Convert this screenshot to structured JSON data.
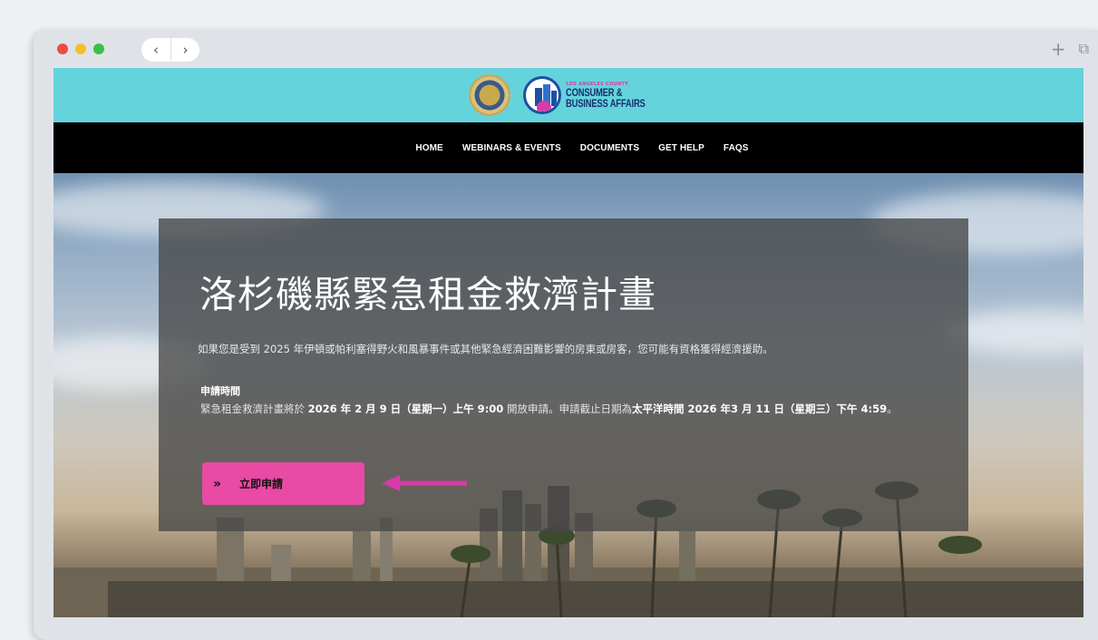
{
  "browser": {
    "back_icon": "‹",
    "forward_icon": "›",
    "new_tab_icon": "+",
    "windows_icon": "⧉"
  },
  "header": {
    "logo_small": "LOS ANGELES COUNTY",
    "logo_line1": "CONSUMER &",
    "logo_line2": "BUSINESS AFFAIRS"
  },
  "nav": {
    "items": [
      {
        "label": "HOME"
      },
      {
        "label": "WEBINARS & EVENTS"
      },
      {
        "label": "DOCUMENTS"
      },
      {
        "label": "GET HELP"
      },
      {
        "label": "FAQS"
      }
    ]
  },
  "hero": {
    "title": "洛杉磯縣緊急租金救濟計畫",
    "description": "如果您是受到 2025 年伊頓或帕利塞得野火和風暴事件或其他緊急經濟困難影響的房東或房客，您可能有資格獲得經濟援助。",
    "period_title": "申請時間",
    "period_text1": "緊急租金救濟計畫將於 ",
    "period_bold1": "2026 年 2 月 9 日（星期一）上午 9:00",
    "period_text2": " 開放申請。申請截止日期為",
    "period_bold2": "太平洋時間 2026 年3 月 11 日（星期三）下午 4:59",
    "period_text3": "。",
    "apply_chevron": "»",
    "apply_label": "立即申請"
  },
  "colors": {
    "header_bg": "#65d3dc",
    "nav_bg": "#000000",
    "button_bg": "#e84aa4",
    "arrow": "#d63ba6"
  }
}
